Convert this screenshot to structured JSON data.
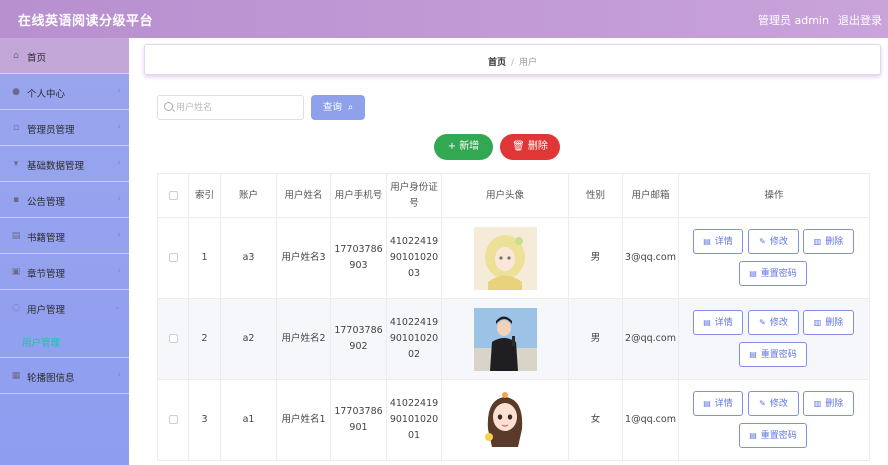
{
  "header": {
    "title": "在线英语阅读分级平台",
    "admin_label": "管理员 admin",
    "logout_label": "退出登录"
  },
  "sidebar": {
    "items": [
      {
        "label": "首页",
        "icon": "home-icon"
      },
      {
        "label": "个人中心",
        "icon": "user-icon"
      },
      {
        "label": "管理员管理",
        "icon": "admin-icon"
      },
      {
        "label": "基础数据管理",
        "icon": "data-icon"
      },
      {
        "label": "公告管理",
        "icon": "notice-icon"
      },
      {
        "label": "书籍管理",
        "icon": "book-icon"
      },
      {
        "label": "章节管理",
        "icon": "chapter-icon"
      },
      {
        "label": "用户管理",
        "icon": "users-icon"
      },
      {
        "label": "轮播图信息",
        "icon": "carousel-icon"
      }
    ],
    "sub_item": "用户管理"
  },
  "breadcrumb": {
    "home": "首页",
    "separator": "/",
    "current": "用户"
  },
  "search": {
    "placeholder": "用户姓名",
    "value": "",
    "query_label": "查询"
  },
  "actions": {
    "add_label": "新增",
    "delete_label": "删除"
  },
  "table": {
    "headers": [
      "",
      "索引",
      "账户",
      "用户姓名",
      "用户手机号",
      "用户身份证号",
      "用户头像",
      "性别",
      "用户邮箱",
      "操作"
    ],
    "rows": [
      {
        "index": "1",
        "account": "a3",
        "name": "用户姓名3",
        "phone": "17703786903",
        "id_card": "410224199010102003",
        "gender": "男",
        "email": "3@qq.com"
      },
      {
        "index": "2",
        "account": "a2",
        "name": "用户姓名2",
        "phone": "17703786902",
        "id_card": "410224199010102002",
        "gender": "男",
        "email": "2@qq.com"
      },
      {
        "index": "3",
        "account": "a1",
        "name": "用户姓名1",
        "phone": "17703786901",
        "id_card": "410224199010102001",
        "gender": "女",
        "email": "1@qq.com"
      }
    ],
    "op_labels": {
      "detail": "详情",
      "edit": "修改",
      "remove": "删除",
      "reset": "重置密码"
    }
  },
  "colors": {
    "header": "#c29bd6",
    "sidebar": "#9aa6ee",
    "add": "#33a853",
    "delete": "#e13636",
    "query": "#8fa1ea",
    "active_sub": "#18c9a3"
  }
}
